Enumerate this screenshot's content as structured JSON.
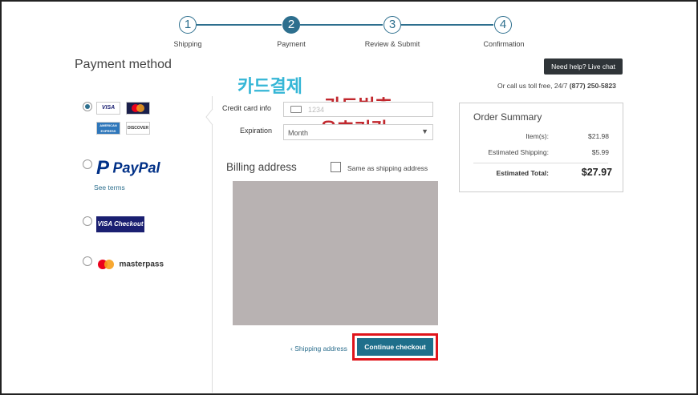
{
  "stepper": {
    "steps": [
      {
        "number": "1",
        "label": "Shipping"
      },
      {
        "number": "2",
        "label": "Payment"
      },
      {
        "number": "3",
        "label": "Review & Submit"
      },
      {
        "number": "4",
        "label": "Confirmation"
      }
    ],
    "active_step": "2"
  },
  "page_title": "Payment method",
  "annotations": {
    "card_payment": "카드결제",
    "card_number": "카드번호",
    "expiry": "유효기간"
  },
  "payment_options": {
    "card_brands": [
      "VISA",
      "MasterCard",
      "AMERICAN EXPRESS",
      "DISCOVER"
    ],
    "paypal_label": "PayPal",
    "paypal_terms": "See terms",
    "visa_checkout_label": "VISA Checkout",
    "masterpass_label": "masterpass"
  },
  "card_form": {
    "credit_card_label": "Credit card info",
    "card_placeholder": "1234",
    "expiration_label": "Expiration",
    "month_value": "Month"
  },
  "billing": {
    "title": "Billing address",
    "same_as_shipping": "Same as shipping address"
  },
  "help": {
    "live_chat": "Need help? Live chat",
    "call_text": "Or call us toll free, 24/7",
    "phone": "(877) 250-5823"
  },
  "order_summary": {
    "title": "Order Summary",
    "items_label": "Item(s):",
    "items_value": "$21.98",
    "shipping_label": "Estimated Shipping:",
    "shipping_value": "$5.99",
    "total_label": "Estimated Total:",
    "total_value": "$27.97"
  },
  "footer": {
    "back_link": "‹ Shipping address",
    "continue_label": "Continue checkout"
  },
  "colors": {
    "accent": "#2d6f8e",
    "annotation_blue": "#35b6d6",
    "annotation_red": "#c1272d",
    "highlight_border": "#e0141b"
  }
}
